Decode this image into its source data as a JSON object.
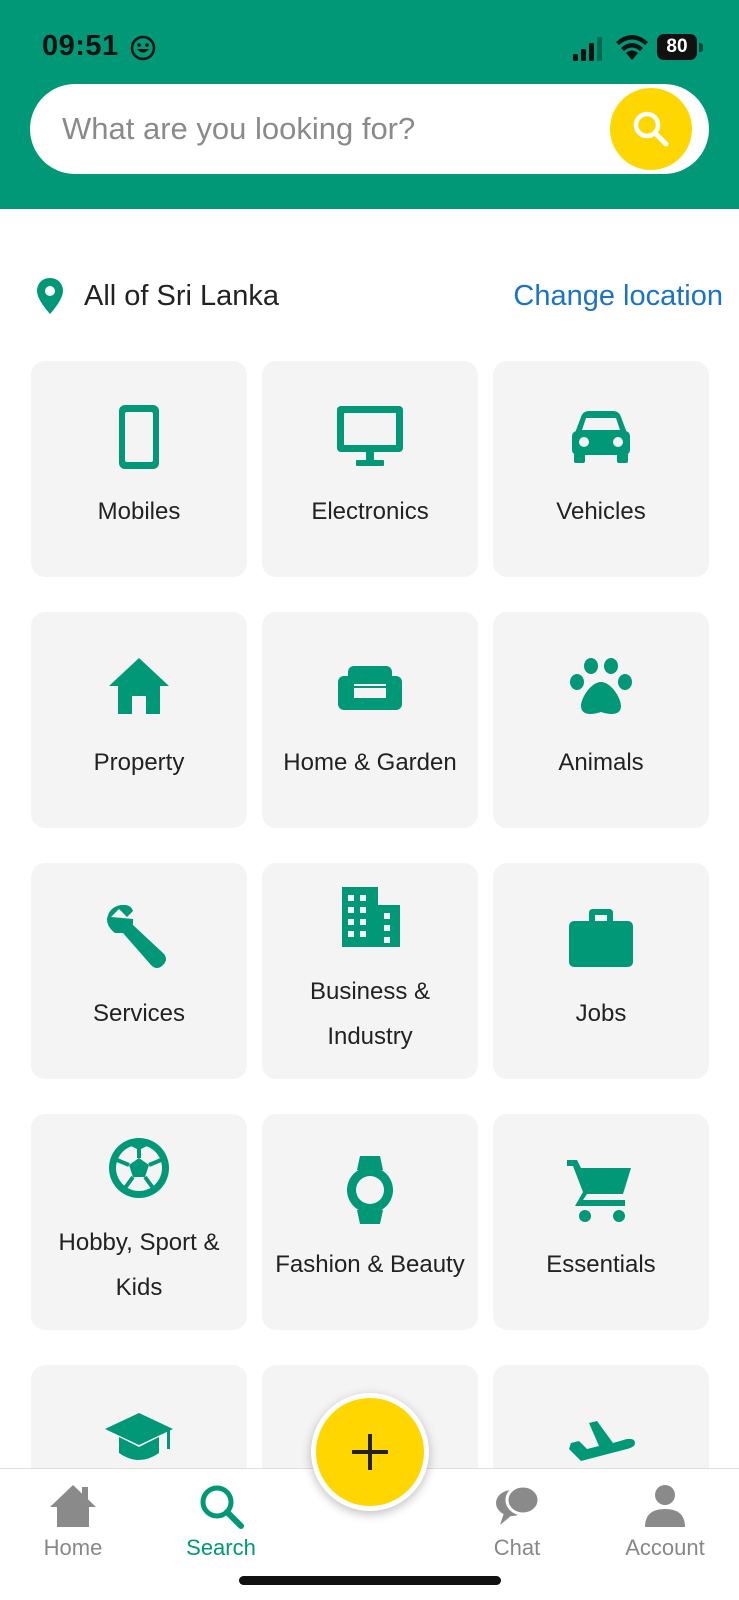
{
  "status_bar": {
    "time": "09:51",
    "battery": "80"
  },
  "search": {
    "placeholder": "What are you looking for?"
  },
  "location": {
    "current": "All of Sri Lanka",
    "change_label": "Change location"
  },
  "categories": [
    {
      "label": "Mobiles",
      "icon": "mobile-phone-icon"
    },
    {
      "label": "Electronics",
      "icon": "monitor-icon"
    },
    {
      "label": "Vehicles",
      "icon": "car-icon"
    },
    {
      "label": "Property",
      "icon": "house-icon"
    },
    {
      "label": "Home & Garden",
      "icon": "sofa-icon"
    },
    {
      "label": "Animals",
      "icon": "paw-icon"
    },
    {
      "label": "Services",
      "icon": "wrench-icon"
    },
    {
      "label_line1": "Business &",
      "label_line2": "Industry",
      "icon": "building-icon"
    },
    {
      "label": "Jobs",
      "icon": "briefcase-icon"
    },
    {
      "label_line1": "Hobby, Sport &",
      "label_line2": "Kids",
      "icon": "soccer-ball-icon"
    },
    {
      "label": "Fashion & Beauty",
      "icon": "watch-icon"
    },
    {
      "label": "Essentials",
      "icon": "shopping-cart-icon"
    },
    {
      "label": "",
      "icon": "graduation-cap-icon"
    },
    {
      "label": "",
      "icon": ""
    },
    {
      "label": "",
      "icon": "airplane-icon"
    }
  ],
  "bottom_nav": {
    "home": "Home",
    "search": "Search",
    "chat": "Chat",
    "account": "Account"
  },
  "colors": {
    "brand_green": "#009877",
    "accent_yellow": "#ffd700",
    "link_blue": "#1a73c8",
    "tile_bg": "#f4f4f4"
  }
}
